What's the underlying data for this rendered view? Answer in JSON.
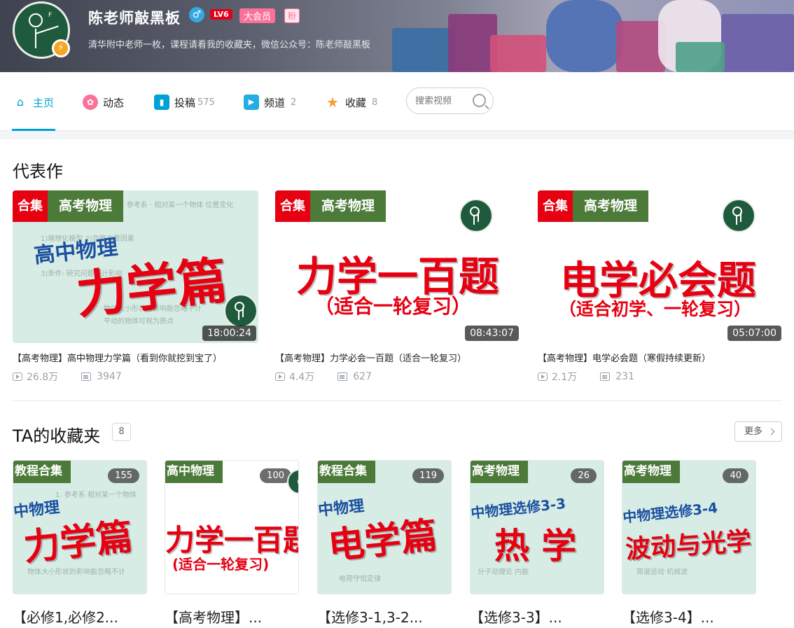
{
  "profile": {
    "name": "陈老师敲黑板",
    "gender_symbol": "♂",
    "level": "LV6",
    "vip": "大会员",
    "fan_badge": "粉",
    "sign": "清华附中老师一枚，课程请看我的收藏夹，微信公众号：陈老师敲黑板",
    "verify_symbol": "⚡"
  },
  "nav": {
    "items": [
      {
        "label": "主页",
        "count": "",
        "icon": "home-icon",
        "color": "#00a1d6"
      },
      {
        "label": "动态",
        "count": "",
        "icon": "dynamic-icon",
        "color": "#fb7299"
      },
      {
        "label": "投稿",
        "count": "575",
        "icon": "upload-icon",
        "color": "#00a1d6"
      },
      {
        "label": "频道",
        "count": "2",
        "icon": "channel-icon",
        "color": "#23ade5"
      },
      {
        "label": "收藏",
        "count": "8",
        "icon": "favorite-icon",
        "color": "#f3a034"
      }
    ],
    "search_placeholder": "搜索视频"
  },
  "featured": {
    "title": "代表作",
    "videos": [
      {
        "tag_a": "合集",
        "tag_b": "高考物理",
        "cover_sub": "高中物理",
        "cover_main": "力学篇",
        "duration": "18:00:24",
        "title": "【高考物理】高中物理力学篇（看到你就挖到宝了）",
        "views": "26.8万",
        "danmaku": "3947"
      },
      {
        "tag_a": "合集",
        "tag_b": "高考物理",
        "cover_main": "力学一百题",
        "cover_sub": "（适合一轮复习）",
        "duration": "08:43:07",
        "title": "【高考物理】力学必会一百题（适合一轮复习）",
        "views": "4.4万",
        "danmaku": "627"
      },
      {
        "tag_a": "合集",
        "tag_b": "高考物理",
        "cover_main": "电学必会题",
        "cover_sub": "（适合初学、一轮复习）",
        "duration": "05:07:00",
        "title": "【高考物理】电学必会题（寒假持续更新）",
        "views": "2.1万",
        "danmaku": "231"
      }
    ]
  },
  "favorites": {
    "title": "TA的收藏夹",
    "count": "8",
    "more_label": "更多",
    "folders": [
      {
        "tag": "教程合集",
        "badge": "155",
        "cover_sub": "中物理",
        "cover_main": "力学篇",
        "title": "【必修1,必修2..."
      },
      {
        "tag": "高中物理",
        "badge": "100",
        "cover_main": "力学一百题",
        "cover_sub": "(适合一轮复习)",
        "title": "【高考物理】..."
      },
      {
        "tag": "教程合集",
        "badge": "119",
        "cover_sub": "中物理",
        "cover_main": "电学篇",
        "title": "【选修3-1,3-2..."
      },
      {
        "tag": "高考物理",
        "badge": "26",
        "cover_sub": "中物理选修3-3",
        "cover_main": "热 学",
        "title": "【选修3-3】..."
      },
      {
        "tag": "高考物理",
        "badge": "40",
        "cover_sub": "中物理选修3-4",
        "cover_main": "波动与光学",
        "title": "【选修3-4】..."
      }
    ]
  }
}
